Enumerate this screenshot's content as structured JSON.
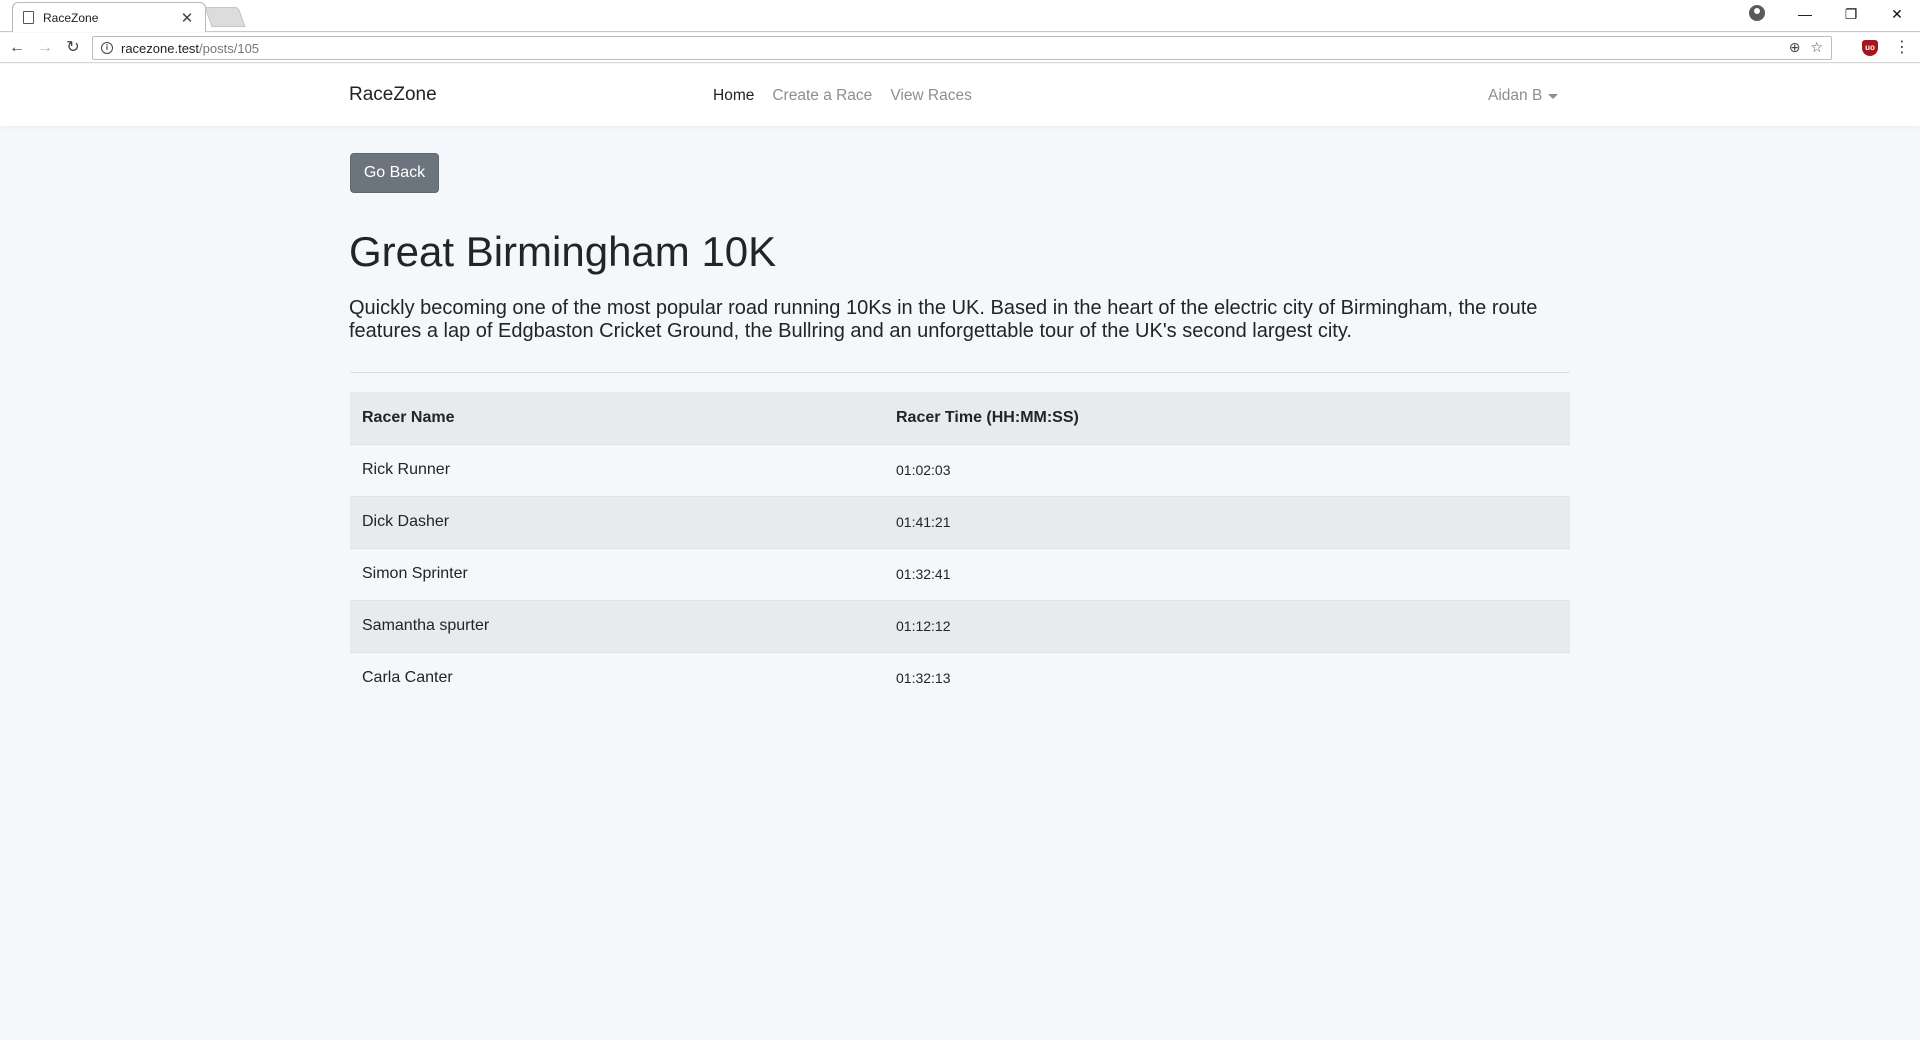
{
  "browser": {
    "tab_title": "RaceZone",
    "url_host": "racezone.test",
    "url_path": "/posts/105"
  },
  "navbar": {
    "brand": "RaceZone",
    "links": [
      "Home",
      "Create a Race",
      "View Races"
    ],
    "user": "Aidan B"
  },
  "page": {
    "back_button": "Go Back",
    "title": "Great Birmingham 10K",
    "description": "Quickly becoming one of the most popular road running 10Ks in the UK. Based in the heart of the electric city of Birmingham, the route features a lap of Edgbaston Cricket Ground, the Bullring and an unforgettable tour of the UK's second largest city."
  },
  "table": {
    "headers": [
      "Racer Name",
      "Racer Time (HH:MM:SS)"
    ],
    "rows": [
      {
        "name": "Rick Runner",
        "time": "01:02:03"
      },
      {
        "name": "Dick Dasher",
        "time": "01:41:21"
      },
      {
        "name": "Simon Sprinter",
        "time": "01:32:41"
      },
      {
        "name": "Samantha spurter",
        "time": "01:12:12"
      },
      {
        "name": "Carla Canter",
        "time": "01:32:13"
      }
    ]
  }
}
